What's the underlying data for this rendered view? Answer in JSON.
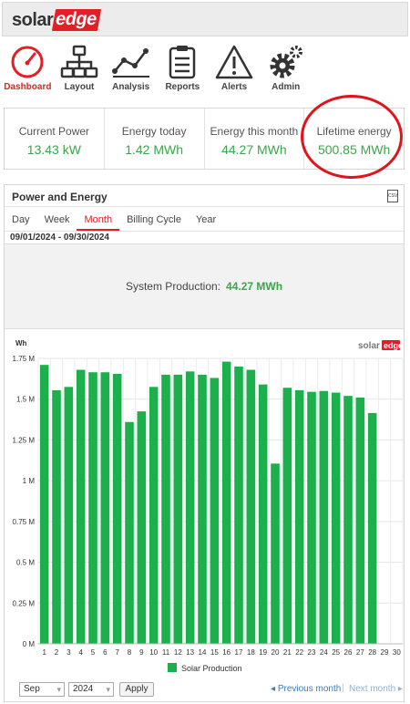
{
  "brand": {
    "solar": "solar",
    "edge": "edge"
  },
  "nav": [
    {
      "id": "dashboard",
      "label": "Dashboard",
      "icon": "speedometer-icon",
      "active": true
    },
    {
      "id": "layout",
      "label": "Layout",
      "icon": "layout-tree-icon",
      "active": false
    },
    {
      "id": "analysis",
      "label": "Analysis",
      "icon": "line-chart-icon",
      "active": false
    },
    {
      "id": "reports",
      "label": "Reports",
      "icon": "clipboard-icon",
      "active": false
    },
    {
      "id": "alerts",
      "label": "Alerts",
      "icon": "warning-icon",
      "active": false
    },
    {
      "id": "admin",
      "label": "Admin",
      "icon": "gears-icon",
      "active": false
    }
  ],
  "kpis": [
    {
      "title": "Current Power",
      "value": "13.43 kW"
    },
    {
      "title": "Energy today",
      "value": "1.42 MWh"
    },
    {
      "title": "Energy this month",
      "value": "44.27 MWh"
    },
    {
      "title": "Lifetime energy",
      "value": "500.85 MWh"
    }
  ],
  "panel": {
    "title": "Power and Energy",
    "csv_label": "CSV",
    "tabs": [
      "Day",
      "Week",
      "Month",
      "Billing Cycle",
      "Year"
    ],
    "active_tab": "Month",
    "date_range": "09/01/2024 - 09/30/2024",
    "system_production_label": "System Production:",
    "system_production_value": "44.27 MWh"
  },
  "chart_data": {
    "type": "bar",
    "ylabel": "Wh",
    "ylim": [
      0,
      1750000
    ],
    "yticks": [
      0,
      250000,
      500000,
      750000,
      1000000,
      1250000,
      1500000,
      1750000
    ],
    "ytick_labels": [
      "0 M",
      "0.25 M",
      "0.5 M",
      "0.75 M",
      "1 M",
      "1.25 M",
      "1.5 M",
      "1.75 M"
    ],
    "categories": [
      "1",
      "2",
      "3",
      "4",
      "5",
      "6",
      "7",
      "8",
      "9",
      "10",
      "11",
      "12",
      "13",
      "14",
      "15",
      "16",
      "17",
      "18",
      "19",
      "20",
      "21",
      "22",
      "23",
      "24",
      "25",
      "26",
      "27",
      "28",
      "29",
      "30"
    ],
    "series": [
      {
        "name": "Solar Production",
        "color": "#1cb04c",
        "values": [
          1710000,
          1555000,
          1575000,
          1680000,
          1665000,
          1665000,
          1655000,
          1360000,
          1425000,
          1575000,
          1650000,
          1650000,
          1670000,
          1650000,
          1630000,
          1730000,
          1700000,
          1680000,
          1590000,
          1105000,
          1570000,
          1555000,
          1545000,
          1550000,
          1540000,
          1520000,
          1510000,
          1415000,
          null,
          null
        ]
      }
    ],
    "watermark": {
      "solar": "solar",
      "edge": "edge"
    },
    "grid": true,
    "legend_position": "bottom"
  },
  "controls": {
    "month_select": "Sep",
    "year_select": "2024",
    "apply_label": "Apply",
    "prev_label": "Previous month",
    "next_label": "Next month",
    "prev_arrow": "◂",
    "next_arrow": "▸"
  }
}
